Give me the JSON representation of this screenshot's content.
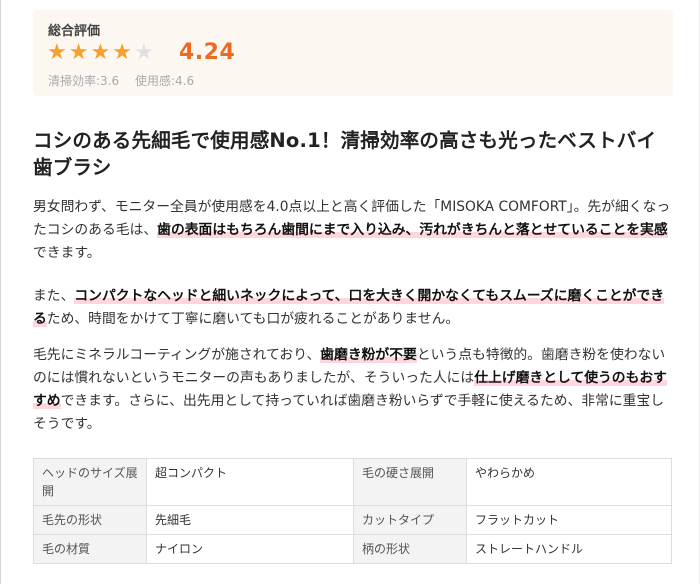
{
  "rating": {
    "label": "総合評価",
    "score": "4.24",
    "stars": {
      "value": 4.24,
      "max": 5
    },
    "sub1": "清掃効率:3.6",
    "sub2": "使用感:4.6"
  },
  "headline": "コシのある先細毛で使用感No.1！清掃効率の高さも光ったベストバイ歯ブラシ",
  "p1": {
    "t1": "男女問わず、モニター全員が使用感を4.0点以上と高く評価した「MISOKA COMFORT」。先が細くなったコシのある毛は、",
    "h1": "歯の表面はもちろん歯間にまで入り込み、汚れがきちんと落とせていることを実感",
    "t2": "できます。"
  },
  "p2": {
    "t1": "また、",
    "h1": "コンパクトなヘッドと細いネックによって、口を大きく開かなくてもスムーズに磨くことができる",
    "t2": "ため、時間をかけて丁寧に磨いても口が疲れることがありません。"
  },
  "p3": {
    "t1": "毛先にミネラルコーティングが施されており、",
    "h1": "歯磨き粉が不要",
    "t2": "という点も特徴的。歯磨き粉を使わないのには慣れないというモニターの声もありましたが、そういった人には",
    "h2": "仕上げ磨きとして使うのもおすすめ",
    "t3": "できます。さらに、出先用として持っていれば歯磨き粉いらずで手軽に使えるため、非常に重宝しそうです。"
  },
  "specs": [
    {
      "k1": "ヘッドのサイズ展開",
      "v1": "超コンパクト",
      "k2": "毛の硬さ展開",
      "v2": "やわらかめ"
    },
    {
      "k1": "毛先の形状",
      "v1": "先細毛",
      "k2": "カットタイプ",
      "v2": "フラットカット"
    },
    {
      "k1": "毛の材質",
      "v1": "ナイロン",
      "k2": "柄の形状",
      "v2": "ストレートハンドル"
    }
  ],
  "colors": {
    "accent": "#ee6a20",
    "star": "#f5a12c",
    "highlight": "#ffd6dd"
  }
}
